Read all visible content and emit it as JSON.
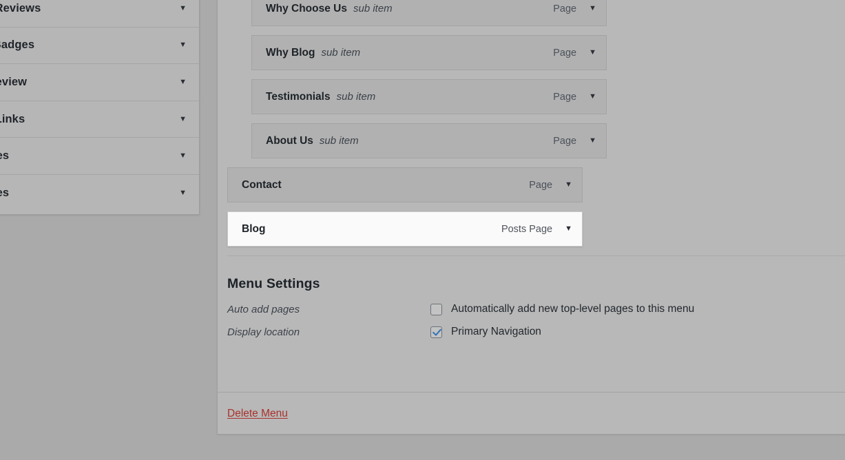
{
  "sidebar": {
    "name": "add-menu-items-accordion",
    "items": [
      {
        "label": "om Reviews",
        "caret": "chevron-down-icon"
      },
      {
        "label": "ew Badges",
        "caret": "chevron-down-icon"
      },
      {
        "label": "le Review",
        "caret": "chevron-down-icon"
      },
      {
        "label": "om Links",
        "caret": "chevron-down-icon"
      },
      {
        "label": "gories",
        "caret": "chevron-down-icon"
      },
      {
        "label": "gories",
        "caret": "chevron-down-icon"
      }
    ]
  },
  "menu_structure": {
    "items": [
      {
        "title": "Why Choose Us",
        "sub": "sub item",
        "type": "Page",
        "level": 1,
        "highlighted": false
      },
      {
        "title": "Why Blog",
        "sub": "sub item",
        "type": "Page",
        "level": 1,
        "highlighted": false
      },
      {
        "title": "Testimonials",
        "sub": "sub item",
        "type": "Page",
        "level": 1,
        "highlighted": false
      },
      {
        "title": "About Us",
        "sub": "sub item",
        "type": "Page",
        "level": 1,
        "highlighted": false
      },
      {
        "title": "Contact",
        "sub": "",
        "type": "Page",
        "level": 0,
        "highlighted": false
      },
      {
        "title": "Blog",
        "sub": "",
        "type": "Posts Page",
        "level": 0,
        "highlighted": true
      }
    ]
  },
  "menu_settings": {
    "heading": "Menu Settings",
    "auto_add": {
      "label": "Auto add pages",
      "checkbox_label": "Automatically add new top-level pages to this menu",
      "checked": false
    },
    "display_location": {
      "label": "Display location",
      "checkbox_label": "Primary Navigation",
      "checked": true
    }
  },
  "footer": {
    "delete_label": "Delete Menu",
    "delete_color": "#a8312b"
  },
  "colors": {
    "overlay_background": "#aaaaaa",
    "panel_background": "#b8b8b8",
    "row_background": "#b1b1b1",
    "highlight_background": "#fafafa",
    "accent_checkbox": "#2e72b8"
  }
}
